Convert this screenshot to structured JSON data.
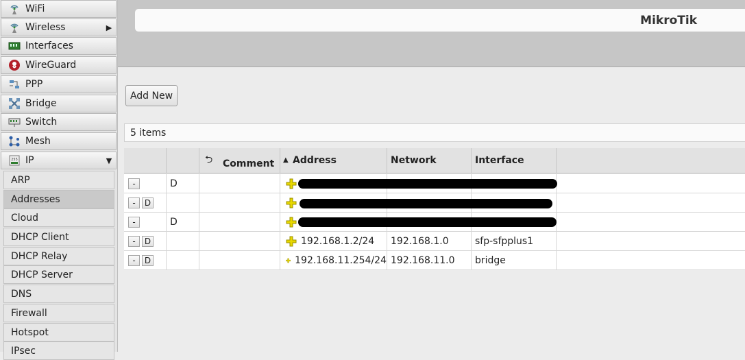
{
  "sidebar": {
    "items": [
      {
        "label": "WiFi",
        "icon": "wifi-antenna-icon",
        "arrow": ""
      },
      {
        "label": "Wireless",
        "icon": "wireless-antenna-icon",
        "arrow": "▶"
      },
      {
        "label": "Interfaces",
        "icon": "interfaces-icon",
        "arrow": ""
      },
      {
        "label": "WireGuard",
        "icon": "wireguard-icon",
        "arrow": ""
      },
      {
        "label": "PPP",
        "icon": "ppp-icon",
        "arrow": ""
      },
      {
        "label": "Bridge",
        "icon": "bridge-icon",
        "arrow": ""
      },
      {
        "label": "Switch",
        "icon": "switch-icon",
        "arrow": ""
      },
      {
        "label": "Mesh",
        "icon": "mesh-icon",
        "arrow": ""
      },
      {
        "label": "IP",
        "icon": "ip-icon",
        "arrow": "▼"
      }
    ],
    "subitems": [
      "ARP",
      "Addresses",
      "Cloud",
      "DHCP Client",
      "DHCP Relay",
      "DHCP Server",
      "DNS",
      "Firewall",
      "Hotspot",
      "IPsec"
    ],
    "active_subitem": "Addresses"
  },
  "header": {
    "brand": "MikroTik"
  },
  "toolbar": {
    "add_new_label": "Add New"
  },
  "list": {
    "count_label": "5 items"
  },
  "table": {
    "columns": {
      "comment": "Comment",
      "address": "Address",
      "network": "Network",
      "interface": "Interface"
    },
    "sort_indicator": "▲",
    "rows": [
      {
        "remove": "-",
        "disable": "",
        "flag": "D",
        "address": "",
        "network": "",
        "interface": "",
        "redacted": true
      },
      {
        "remove": "-",
        "disable": "D",
        "flag": "",
        "address": "",
        "network": "",
        "interface": "",
        "redacted": true
      },
      {
        "remove": "-",
        "disable": "",
        "flag": "D",
        "address": "",
        "network": "",
        "interface": "",
        "redacted": true
      },
      {
        "remove": "-",
        "disable": "D",
        "flag": "",
        "address": "192.168.1.2/24",
        "network": "192.168.1.0",
        "interface": "sfp-sfpplus1",
        "redacted": false
      },
      {
        "remove": "-",
        "disable": "D",
        "flag": "",
        "address": "192.168.11.254/24",
        "network": "192.168.11.0",
        "interface": "bridge",
        "redacted": false
      }
    ]
  },
  "colors": {
    "plus_icon": "#e8d800",
    "plus_outline": "#9a8f00"
  }
}
